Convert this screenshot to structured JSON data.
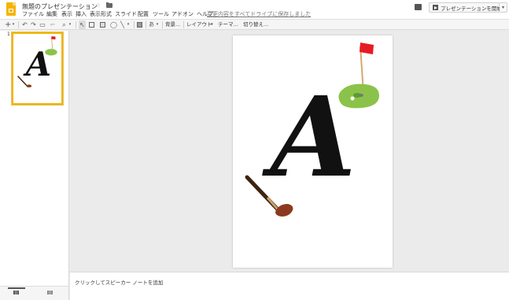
{
  "document": {
    "title": "無題のプレゼンテーション",
    "save_status": "変更内容をすべてドライブに保存しました"
  },
  "menu": [
    "ファイル",
    "編集",
    "表示",
    "挿入",
    "表示形式",
    "スライド",
    "配置",
    "ツール",
    "アドオン",
    "ヘルプ"
  ],
  "header": {
    "present_label": "プレゼンテーションを開始",
    "present_dropdown": "▾"
  },
  "toolbar": {
    "add": "+",
    "add_caret": "▾",
    "undo": "↶",
    "redo": "↷",
    "zoom_caret": "▾",
    "cursor": "↖",
    "line_caret": "▾",
    "input_tools": "あ",
    "input_caret": "▾",
    "background": "背景...",
    "layout": "レイアウト",
    "layout_caret": "▾",
    "theme": "テーマ...",
    "transition": "切り替え..."
  },
  "filmstrip": {
    "slide_numbers": [
      "1"
    ]
  },
  "slide": {
    "letter": "A"
  },
  "notes": {
    "placeholder": "クリックしてスピーカー ノートを追加"
  },
  "colors": {
    "accent": "#f4b400",
    "flag_red": "#e51c23",
    "green": "#8bc34a",
    "club_brown": "#8b3a1e"
  },
  "icons": {
    "logo": "slides-logo-icon",
    "star": "star-icon",
    "folder": "folder-icon",
    "comment": "comment-icon",
    "present": "present-icon"
  }
}
